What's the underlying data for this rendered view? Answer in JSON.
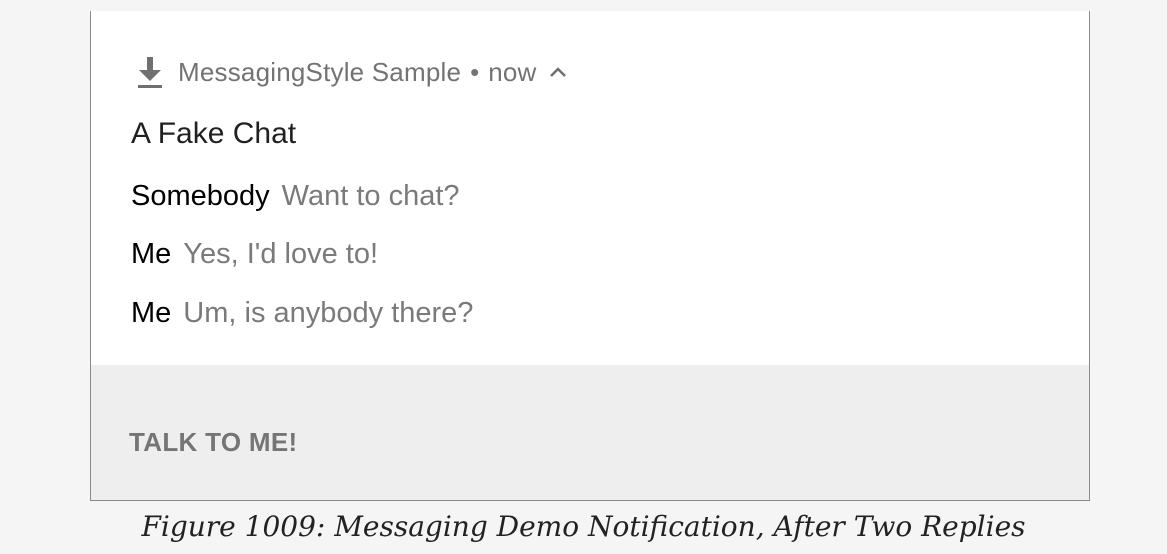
{
  "notification": {
    "app_name": "MessagingStyle Sample",
    "separator": "•",
    "time": "now",
    "icon": "download-icon",
    "expand_icon": "chevron-up-icon",
    "title": "A Fake Chat",
    "messages": [
      {
        "sender": "Somebody",
        "text": "Want to chat?"
      },
      {
        "sender": "Me",
        "text": "Yes, I'd love to!"
      },
      {
        "sender": "Me",
        "text": "Um, is anybody there?"
      }
    ],
    "action_label": "TALK TO ME!"
  },
  "caption": "Figure 1009: Messaging Demo Notification, After Two Replies",
  "colors": {
    "page_background": "#f5f5f5",
    "card_background": "#ffffff",
    "action_bar_background": "#eeeeee",
    "secondary_text": "#757575"
  }
}
